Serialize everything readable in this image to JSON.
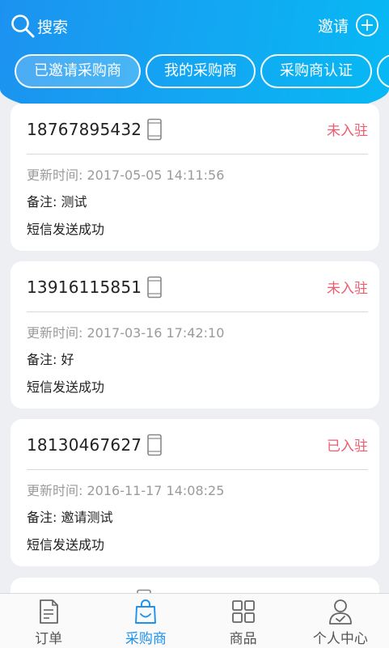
{
  "header": {
    "search_label": "搜索",
    "invite_label": "邀请"
  },
  "tabs": [
    {
      "label": "已邀请采购商",
      "active": true
    },
    {
      "label": "我的采购商",
      "active": false
    },
    {
      "label": "采购商认证",
      "active": false
    },
    {
      "label": "",
      "active": false
    }
  ],
  "cards": [
    {
      "phone": "18767895432",
      "status": "未入驻",
      "time": "更新时间:  2017-05-05 14:11:56",
      "note": "备注:  测试",
      "sms": "短信发送成功"
    },
    {
      "phone": "13916115851",
      "status": "未入驻",
      "time": "更新时间:  2017-03-16 17:42:10",
      "note": "备注:  好",
      "sms": "短信发送成功"
    },
    {
      "phone": "18130467627",
      "status": "已入驻",
      "time": "更新时间:  2016-11-17 14:08:25",
      "note": "备注:  邀请测试",
      "sms": "短信发送成功"
    }
  ],
  "bottom_nav": [
    {
      "label": "订单",
      "icon": "order-icon",
      "active": false
    },
    {
      "label": "采购商",
      "icon": "buyer-bag-icon",
      "active": true
    },
    {
      "label": "商品",
      "icon": "goods-grid-icon",
      "active": false
    },
    {
      "label": "个人中心",
      "icon": "profile-icon",
      "active": false
    }
  ],
  "colors": {
    "accent": "#1c92f0",
    "status": "#f05a6e"
  }
}
